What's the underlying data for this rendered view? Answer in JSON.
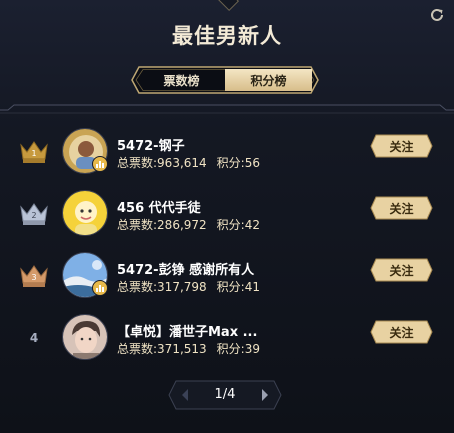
{
  "header": {
    "title": "最佳男新人",
    "refresh_icon": "refresh-icon"
  },
  "tabs": [
    {
      "label": "票数榜",
      "active": false
    },
    {
      "label": "积分榜",
      "active": true
    }
  ],
  "leaderboard": {
    "votes_prefix": "总票数:",
    "points_prefix": "积分:",
    "follow_label": "关注",
    "rows": [
      {
        "rank": "1",
        "rank_icon": "gold-crown-icon",
        "name": "5472-钢子",
        "votes": "963,614",
        "points": "56",
        "live": true
      },
      {
        "rank": "2",
        "rank_icon": "silver-crown-icon",
        "name": "456 代代手徒",
        "votes": "286,972",
        "points": "42",
        "live": false
      },
      {
        "rank": "3",
        "rank_icon": "bronze-crown-icon",
        "name": "5472-彭铮 感谢所有人",
        "votes": "317,798",
        "points": "41",
        "live": true
      },
      {
        "rank": "4",
        "rank_icon": "",
        "name": "【卓悦】潘世子Max ...",
        "votes": "371,513",
        "points": "39",
        "live": false
      }
    ]
  },
  "pager": {
    "label": "1/4"
  },
  "colors": {
    "gold": "#e5c98f",
    "crown_gold": "#c79a3e",
    "crown_silver": "#b9c3d6",
    "crown_bronze": "#d49a6a",
    "follow_button": "#e8d2a2",
    "background": "#141823"
  }
}
